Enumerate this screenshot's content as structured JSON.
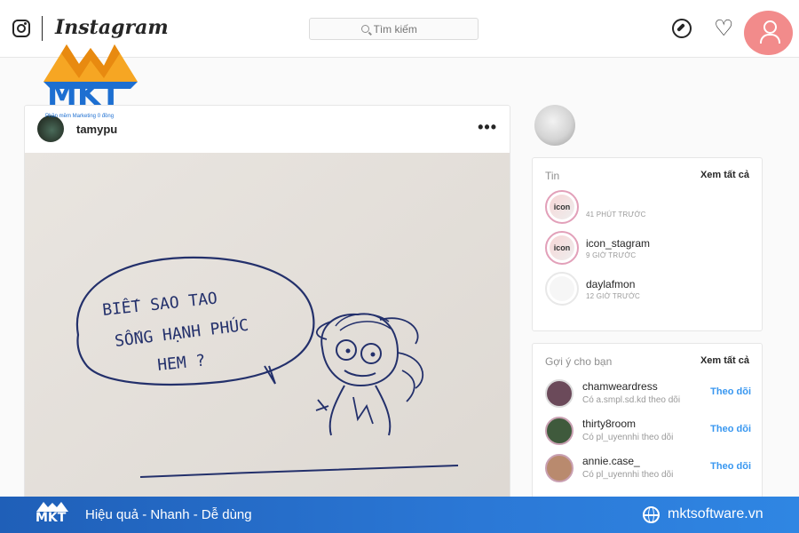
{
  "topnav": {
    "wordmark": "Instagram",
    "search_placeholder": "Tìm kiếm"
  },
  "watermark": {
    "logo_text": "MKT",
    "logo_sub": "Phần mềm Marketing 0 đồng"
  },
  "post": {
    "username": "tamypu",
    "more": "•••",
    "image_handwriting": [
      "BIẾT SAO TAO",
      "SỐNG HẠNH PHÚC",
      "HEM ?"
    ]
  },
  "stories": {
    "title": "Tin",
    "see_all": "Xem tất cả",
    "items": [
      {
        "name": "",
        "time": "41 PHÚT TRƯỚC",
        "avatar_text": "icon"
      },
      {
        "name": "icon_stagram",
        "time": "9 GIỜ TRƯỚC",
        "avatar_text": "icon"
      },
      {
        "name": "daylafmon",
        "time": "12 GIỜ TRƯỚC",
        "avatar_text": ""
      }
    ]
  },
  "suggestions": {
    "title": "Gợi ý cho bạn",
    "see_all": "Xem tất cả",
    "follow_label": "Theo dõi",
    "items": [
      {
        "name": "chamweardress",
        "sub": "Có a.smpl.sd.kd theo dõi"
      },
      {
        "name": "thirty8room",
        "sub": "Có pl_uyennhi theo dõi"
      },
      {
        "name": "annie.case_",
        "sub": "Có pl_uyennhi theo dõi"
      }
    ]
  },
  "banner": {
    "logo_text": "MKT",
    "tagline": "Hiệu quả - Nhanh - Dễ dùng",
    "website": "mktsoftware.vn"
  },
  "colors": {
    "accent_link": "#3897f0",
    "banner_blue": "#2b78d6",
    "profile_highlight": "#f28b8b",
    "story_ring": "#e2a0b9"
  }
}
